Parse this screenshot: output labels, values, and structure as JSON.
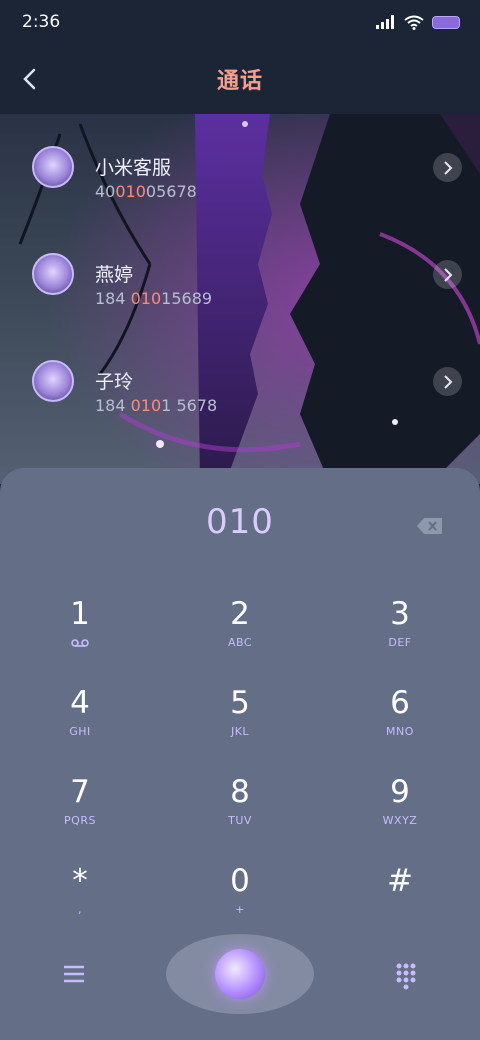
{
  "status": {
    "time": "2:36"
  },
  "header": {
    "title": "通话"
  },
  "contacts": [
    {
      "name": "小米客服",
      "num_pre": "40",
      "num_hl": "010",
      "num_post": "05678"
    },
    {
      "name": "燕婷",
      "num_pre": "184 ",
      "num_hl": "010",
      "num_post": "15689"
    },
    {
      "name": "子玲",
      "num_pre": "184 ",
      "num_hl": "010",
      "num_post": "1 5678"
    }
  ],
  "dialer": {
    "input": "010",
    "keys": [
      {
        "digit": "1",
        "letters": ""
      },
      {
        "digit": "2",
        "letters": "ABC"
      },
      {
        "digit": "3",
        "letters": "DEF"
      },
      {
        "digit": "4",
        "letters": "GHI"
      },
      {
        "digit": "5",
        "letters": "JKL"
      },
      {
        "digit": "6",
        "letters": "MNO"
      },
      {
        "digit": "7",
        "letters": "PQRS"
      },
      {
        "digit": "8",
        "letters": "TUV"
      },
      {
        "digit": "9",
        "letters": "WXYZ"
      },
      {
        "digit": "*",
        "letters": ","
      },
      {
        "digit": "0",
        "letters": "+"
      },
      {
        "digit": "#",
        "letters": ""
      }
    ]
  },
  "colors": {
    "title": "#f4a08d",
    "highlight": "#ff8a78",
    "accent": "#c8bbff",
    "panel": "#646e86"
  },
  "icons": [
    "back-icon",
    "voicemail-icon",
    "backspace-icon",
    "menu-icon",
    "call-icon",
    "dialpad-icon",
    "chevron-right-icon"
  ]
}
